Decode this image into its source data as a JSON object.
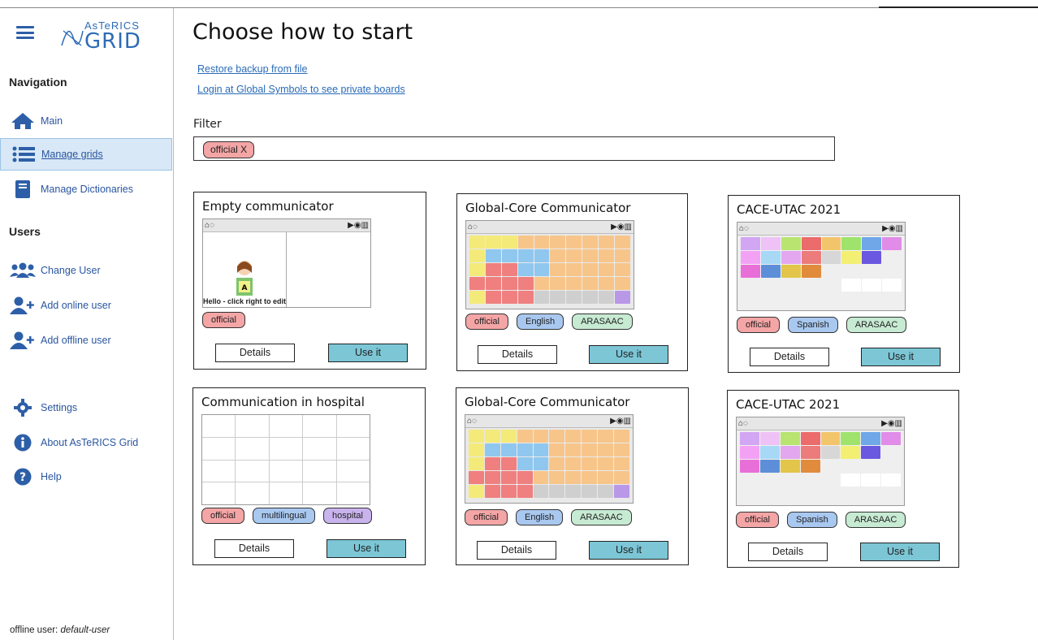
{
  "sidebar": {
    "logo_top": "AsTeRICS",
    "logo_bottom": "GRID",
    "navigation_heading": "Navigation",
    "nav": [
      {
        "label": "Main",
        "icon": "home-icon"
      },
      {
        "label": "Manage grids",
        "icon": "list-icon"
      },
      {
        "label": "Manage Dictionaries",
        "icon": "book-icon"
      }
    ],
    "users_heading": "Users",
    "users": [
      {
        "label": "Change User",
        "icon": "users-icon"
      },
      {
        "label": "Add online user",
        "icon": "user-plus-icon"
      },
      {
        "label": "Add offline user",
        "icon": "user-plus-icon"
      }
    ],
    "bottom": [
      {
        "label": "Settings",
        "icon": "gear-icon"
      },
      {
        "label": "About AsTeRICS Grid",
        "icon": "info-icon"
      },
      {
        "label": "Help",
        "icon": "question-icon"
      }
    ],
    "offline_prefix": "offline user:",
    "offline_user": "default-user"
  },
  "main": {
    "title": "Choose how to start",
    "restore_link": "Restore backup from file",
    "login_link": "Login at Global Symbols to see private boards",
    "filter_label": "Filter",
    "filter_tag": "official  X"
  },
  "cards": [
    {
      "title": "Empty communicator",
      "tags": [
        "official"
      ],
      "details": "Details",
      "use": "Use it",
      "cell_text": "Hello - click right to edit"
    },
    {
      "title": "Global-Core Communicator",
      "tags": [
        "official",
        "English",
        "ARASAAC"
      ],
      "details": "Details",
      "use": "Use it"
    },
    {
      "title": "CACE-UTAC 2021",
      "tags": [
        "official",
        "Spanish",
        "ARASAAC"
      ],
      "details": "Details",
      "use": "Use it"
    },
    {
      "title": "Communication in hospital",
      "tags": [
        "official",
        "multilingual",
        "hospital"
      ],
      "details": "Details",
      "use": "Use it"
    },
    {
      "title": "Global-Core Communicator",
      "tags": [
        "official",
        "English",
        "ARASAAC"
      ],
      "details": "Details",
      "use": "Use it"
    },
    {
      "title": "CACE-UTAC 2021",
      "tags": [
        "official",
        "Spanish",
        "ARASAAC"
      ],
      "details": "Details",
      "use": "Use it"
    }
  ],
  "colors": {
    "accent_blue": "#2d5fa8",
    "tag_official": "#f4a5a5",
    "tag_language": "#a9c8f0",
    "tag_source": "#c7ead3",
    "tag_hospital": "#c9b3ec",
    "use_button": "#7cc6d6",
    "active_nav": "#d8e8f6"
  }
}
